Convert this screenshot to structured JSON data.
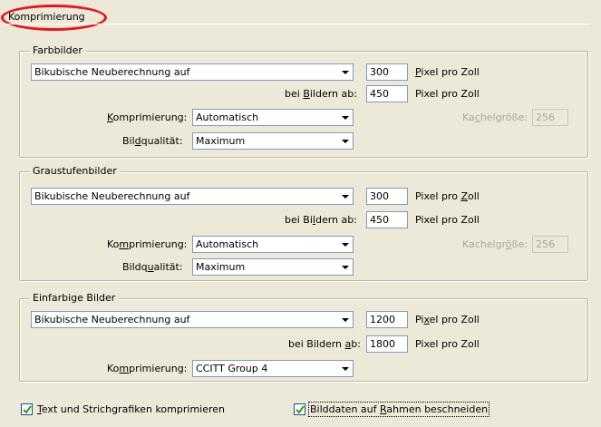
{
  "page": {
    "title": "Komprimierung"
  },
  "colors": {
    "background": "#ece9d8",
    "highlight_oval": "#e8161c",
    "field_border": "#7f9db9",
    "disabled_text": "#aca899"
  },
  "groups": {
    "color": {
      "legend": "Farbbilder",
      "downsample_value": "Bikubische Neuberechnung auf",
      "ppi_value": "300",
      "ppi_unit_pre": "",
      "ppi_unit_u": "P",
      "ppi_unit_post": "ixel pro Zoll",
      "threshold_pre": "bei ",
      "threshold_u": "B",
      "threshold_post": "ildern ab:",
      "threshold_value": "450",
      "threshold_unit": "Pixel pro Zoll",
      "compression_pre": "",
      "compression_u": "K",
      "compression_post": "omprimierung:",
      "compression_value": "Automatisch",
      "quality_pre": "Bil",
      "quality_u": "d",
      "quality_post": "qualität:",
      "quality_value": "Maximum",
      "tile_pre": "Ka",
      "tile_u": "c",
      "tile_post": "helgröße:",
      "tile_value": "256"
    },
    "gray": {
      "legend": "Graustufenbilder",
      "downsample_value": "Bikubische Neuberechnung auf",
      "ppi_value": "300",
      "ppi_unit_pre": "Pixel pro ",
      "ppi_unit_u": "Z",
      "ppi_unit_post": "oll",
      "threshold_pre": "bei Bi",
      "threshold_u": "l",
      "threshold_post": "dern ab:",
      "threshold_value": "450",
      "threshold_unit": "Pixel pro Zoll",
      "compression_pre": "Ko",
      "compression_u": "m",
      "compression_post": "primierung:",
      "compression_value": "Automatisch",
      "quality_pre": "Bildq",
      "quality_u": "u",
      "quality_post": "alität:",
      "quality_value": "Maximum",
      "tile_pre": "Kachelgr",
      "tile_u": "ö",
      "tile_post": "ße:",
      "tile_value": "256"
    },
    "mono": {
      "legend": "Einfarbige Bilder",
      "downsample_value": "Bikubische Neuberechnung auf",
      "ppi_value": "1200",
      "ppi_unit_pre": "Pi",
      "ppi_unit_u": "x",
      "ppi_unit_post": "el pro Zoll",
      "threshold_pre": "bei Bildern ",
      "threshold_u": "a",
      "threshold_post": "b:",
      "threshold_value": "1800",
      "threshold_unit": "Pixel pro Zoll",
      "compression_pre": "Ko",
      "compression_u": "m",
      "compression_post": "primierung:",
      "compression_value": "CCITT Group 4"
    }
  },
  "options": {
    "compress_text": {
      "checked": true,
      "label_pre": "",
      "label_u": "T",
      "label_post": "ext und Strichgrafiken komprimieren"
    },
    "crop_images": {
      "checked": true,
      "label_pre": "Bilddaten auf ",
      "label_u": "R",
      "label_post": "ahmen beschneiden"
    }
  }
}
